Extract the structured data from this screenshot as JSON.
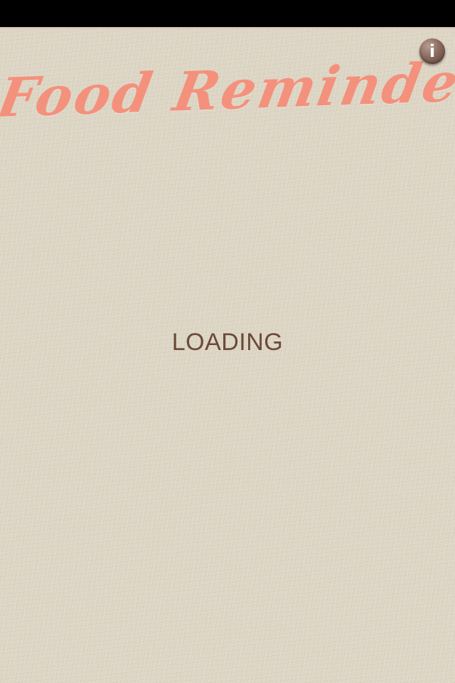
{
  "app": {
    "title": "Food Reminder"
  },
  "status": {
    "loading_text": "LOADING"
  },
  "info_button": {
    "glyph": "i",
    "icon": "info-icon"
  },
  "colors": {
    "background": "#ddd6c5",
    "title": "#f4917c",
    "loading_text": "#6b4a36",
    "info_button": "#8b6b5f",
    "status_bar": "#000000"
  }
}
